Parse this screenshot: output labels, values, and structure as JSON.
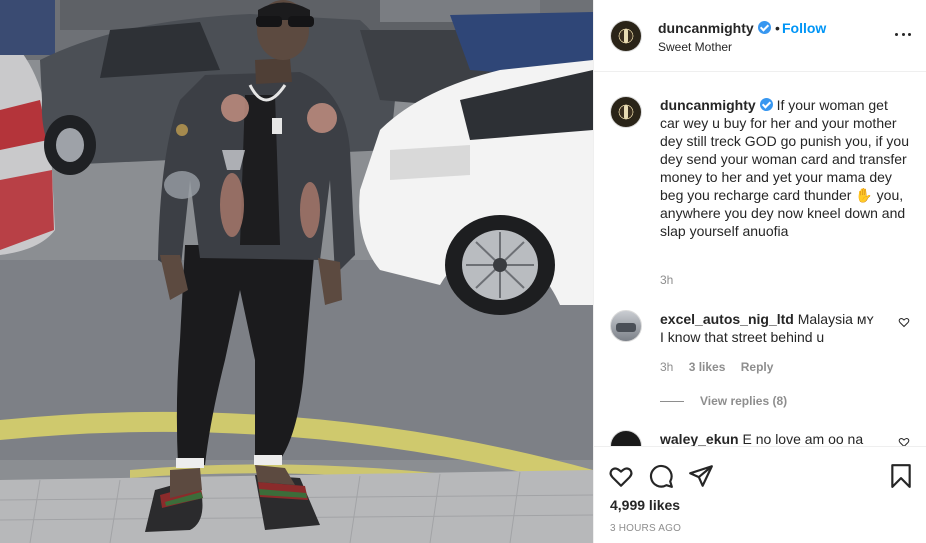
{
  "post": {
    "photo_alt": "",
    "author": {
      "username": "duncanmighty",
      "verified": true,
      "location": "Sweet Mother",
      "follow_label": "Follow"
    },
    "caption": {
      "username": "duncanmighty",
      "text": "If your woman get car wey u buy for her and your mother dey still treck GOD go punish you, if you dey send your woman card and transfer money to her and yet your mama dey beg you recharge card thunder ✋ you, anywhere you dey now kneel down and slap yourself anuofia",
      "time": "3h"
    },
    "comments": [
      {
        "username": "excel_autos_nig_ltd",
        "text": "Malaysia ᴍʏ I know that street behind u",
        "time": "3h",
        "likes": "3 likes",
        "reply_label": "Reply",
        "view_replies": "View replies (8)"
      },
      {
        "username": "waley_ekun",
        "text": "E no love am oo na"
      }
    ],
    "likes": "4,999 likes",
    "timestamp": "3 HOURS AGO"
  },
  "colors": {
    "accent": "#0095f6",
    "verified": "#3897f0",
    "muted": "#8e8e8e",
    "text": "#262626"
  },
  "icons": {
    "like": "heart-icon",
    "comment": "comment-icon",
    "share": "paper-plane-icon",
    "save": "bookmark-icon",
    "more": "more-options-icon",
    "verified": "verified-badge-icon"
  }
}
